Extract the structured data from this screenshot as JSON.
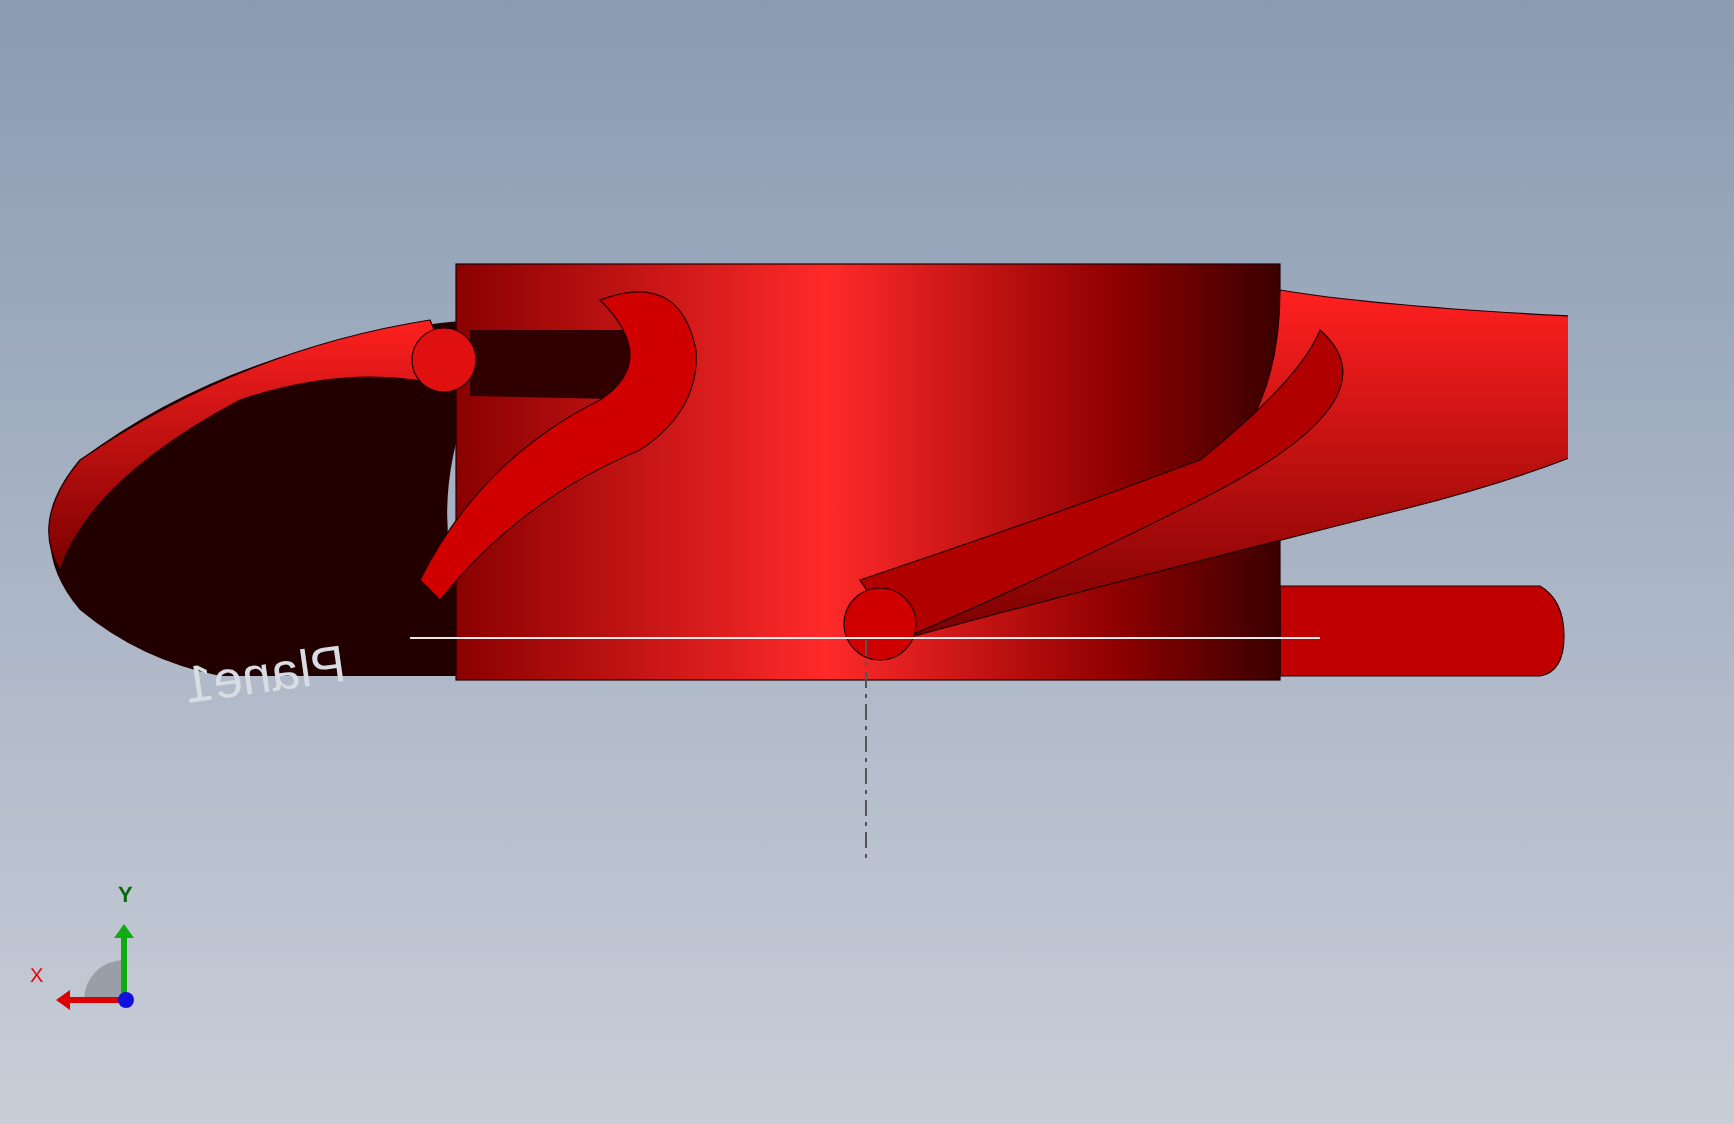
{
  "viewport": {
    "plane_label": "Plane1",
    "triad": {
      "x_label": "X",
      "y_label": "Y"
    }
  }
}
